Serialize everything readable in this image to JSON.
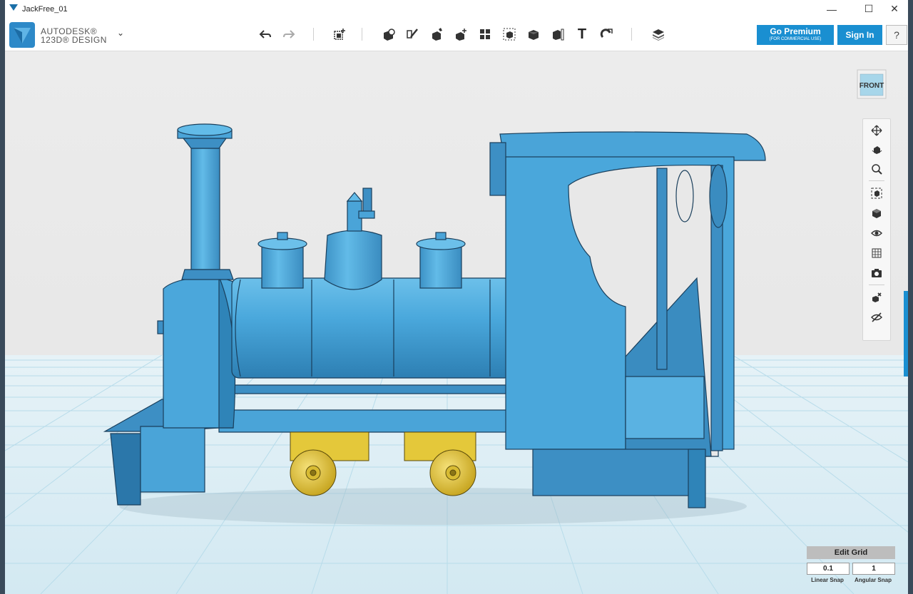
{
  "window": {
    "title": "JackFree_01",
    "minimize": "—",
    "maximize": "☐",
    "close": "✕"
  },
  "brand": {
    "line1": "AUTODESK®",
    "line2": "123D® DESIGN",
    "menu_chevron": "⌄"
  },
  "toolbar": {
    "tools": [
      {
        "name": "undo-icon"
      },
      {
        "name": "redo-icon"
      },
      {
        "name": "transform-icon"
      },
      {
        "name": "primitives-icon"
      },
      {
        "name": "sketch-icon"
      },
      {
        "name": "construct-icon"
      },
      {
        "name": "modify-icon"
      },
      {
        "name": "pattern-icon"
      },
      {
        "name": "group-icon"
      },
      {
        "name": "combine-icon"
      },
      {
        "name": "measure-icon"
      },
      {
        "name": "text-icon"
      },
      {
        "name": "snap-icon"
      },
      {
        "name": "material-icon"
      }
    ],
    "text_tool_glyph": "T"
  },
  "account": {
    "premium_label": "Go Premium",
    "premium_sub": "(FOR COMMERCIAL USE)",
    "signin_label": "Sign In",
    "help_label": "?"
  },
  "viewcube": {
    "face": "FRONT"
  },
  "nav_tools": [
    "pan-icon",
    "orbit-icon",
    "zoom-icon",
    "fit-icon",
    "view-icon",
    "visibility-icon",
    "materials-outlines-icon",
    "snapshot-icon",
    "ungroup-icon",
    "hide-icon"
  ],
  "grid": {
    "edit_label": "Edit Grid",
    "linear_snap": "0.1",
    "linear_label": "Linear Snap",
    "angular_snap": "1",
    "angular_label": "Angular Snap"
  },
  "colors": {
    "accent": "#1a8fd1",
    "model_blue": "#4ca6d8",
    "wheel_yellow": "#e4c83a",
    "grid_line": "#b8dcea"
  }
}
